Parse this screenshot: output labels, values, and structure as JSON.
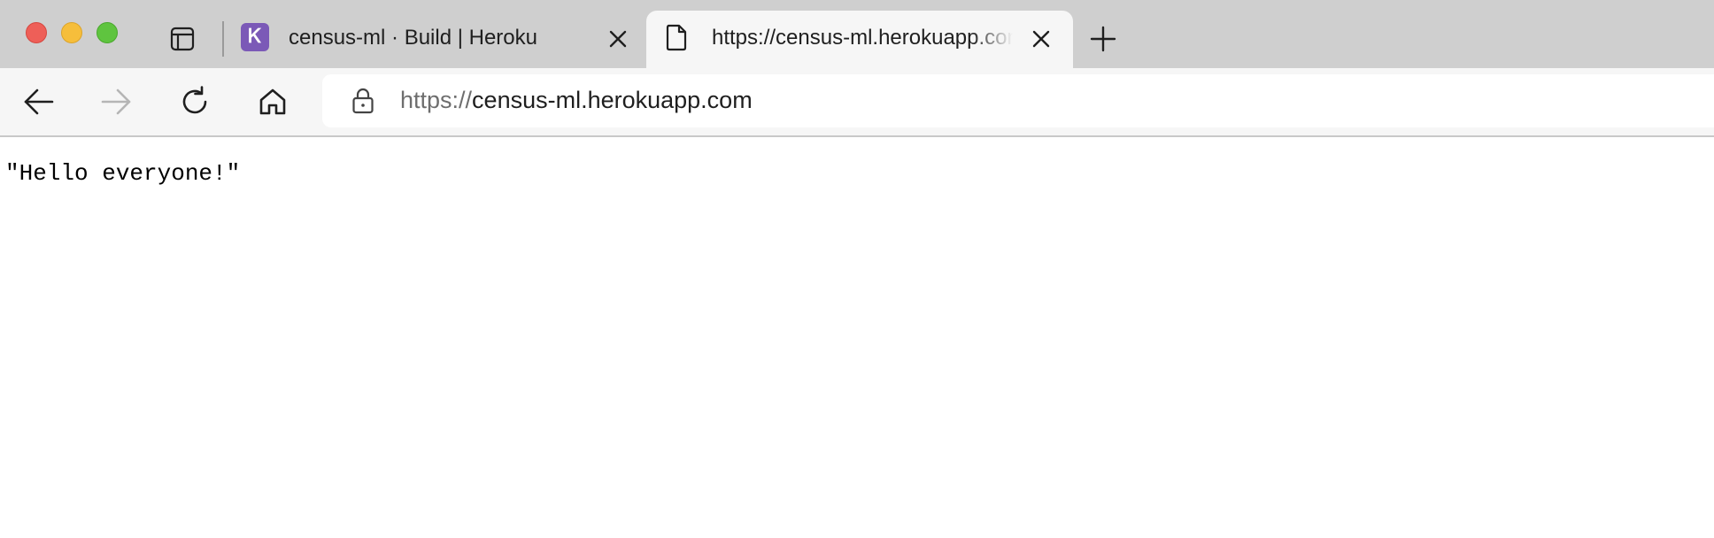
{
  "browser": {
    "tabs": [
      {
        "title": "census-ml · Build | Heroku",
        "favicon": "heroku-logo-icon",
        "favicon_letter": "Ꮶ",
        "favicon_color": "#7b59b7",
        "active": false
      },
      {
        "title": "https://census-ml.herokuapp.com",
        "favicon": "document-icon",
        "active": true
      }
    ],
    "address_bar": {
      "scheme": "https://",
      "host": "census-ml.herokuapp.com"
    }
  },
  "page": {
    "body_text": "\"Hello everyone!\""
  },
  "colors": {
    "traffic_close": "#ee5f58",
    "traffic_minimize": "#f6be3b",
    "traffic_maximize": "#5fc43f",
    "tabstrip_bg": "#cfcfcf",
    "toolbar_bg": "#f6f6f6"
  }
}
